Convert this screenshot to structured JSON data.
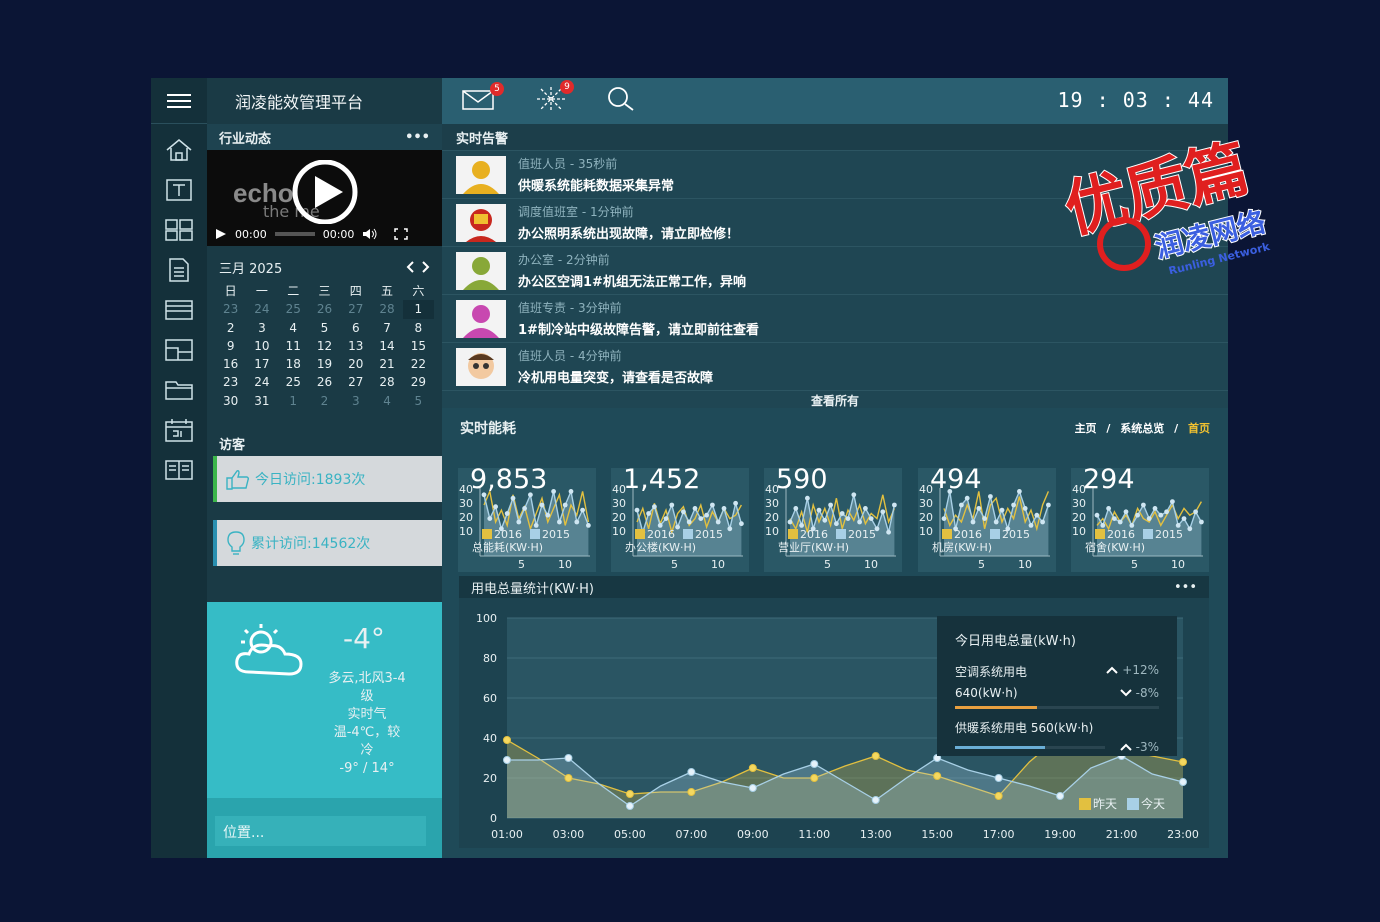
{
  "header": {
    "brand": "润凌能效管理平台",
    "mail_badge": "5",
    "alert_badge": "9",
    "clock": "19 : 03 : 44"
  },
  "sidebar": {
    "news_title": "行业动态",
    "menu": "•••",
    "video": {
      "brand_text1": "echo",
      "brand_text2": "the me",
      "time_current": "00:00",
      "time_total": "00:00"
    },
    "calendar": {
      "month": "三月 2025",
      "weekdays": [
        "日",
        "一",
        "二",
        "三",
        "四",
        "五",
        "六"
      ],
      "days": [
        "23",
        "24",
        "25",
        "26",
        "27",
        "28",
        "1",
        "2",
        "3",
        "4",
        "5",
        "6",
        "7",
        "8",
        "9",
        "10",
        "11",
        "12",
        "13",
        "14",
        "15",
        "16",
        "17",
        "18",
        "19",
        "20",
        "21",
        "22",
        "23",
        "24",
        "25",
        "26",
        "27",
        "28",
        "29",
        "30",
        "31",
        "1",
        "2",
        "3",
        "4",
        "5"
      ],
      "dim": [
        0,
        1,
        2,
        3,
        4,
        5,
        37,
        38,
        39,
        40,
        41
      ],
      "selected": 6
    },
    "visitors": {
      "title": "访客",
      "today": "今日访问:1893次",
      "total": "累计访问:14562次"
    },
    "weather": {
      "temp": "-4°",
      "line1": "多云,北风3-4",
      "line2": "级",
      "line3": "实时气",
      "line4": "温-4℃，较",
      "line5": "冷",
      "range": "-9° / 14°"
    },
    "location_placeholder": "位置..."
  },
  "alerts": {
    "title": "实时告警",
    "see_all": "查看所有",
    "items": [
      {
        "meta": "值班人员 - 35秒前",
        "msg": "供暖系统能耗数据采集异常",
        "avatar": "user-yellow"
      },
      {
        "meta": "调度值班室 - 1分钟前",
        "msg": "办公照明系统出现故障，请立即检修！",
        "avatar": "ironman"
      },
      {
        "meta": "办公室 - 2分钟前",
        "msg": "办公区空调1#机组无法正常工作，异响",
        "avatar": "user-green"
      },
      {
        "meta": "值班专责 - 3分钟前",
        "msg": "1#制冷站中级故障告警，请立即前往查看",
        "avatar": "user-pink"
      },
      {
        "meta": "值班人员 - 4分钟前",
        "msg": "冷机用电量突变，请查看是否故障",
        "avatar": "cartoon"
      }
    ]
  },
  "energy": {
    "title": "实时能耗",
    "breadcrumb": [
      "主页",
      "系统总览",
      "首页"
    ],
    "cards": [
      {
        "value": "9,853",
        "label": "总能耗(KW·H)"
      },
      {
        "value": "1,452",
        "label": "办公楼(KW·H)"
      },
      {
        "value": "590",
        "label": "营业厅(KW·H)"
      },
      {
        "value": "494",
        "label": "机房(KW·H)"
      },
      {
        "value": "294",
        "label": "宿舍(KW·H)"
      }
    ],
    "mini_legend": [
      "2016",
      "2015"
    ],
    "mini_y": [
      "40",
      "30",
      "20",
      "10"
    ],
    "mini_x": [
      "5",
      "10"
    ]
  },
  "chart_data": {
    "type": "area",
    "title": "用电总量统计(KW·H)",
    "menu": "•••",
    "x": [
      "01:00",
      "02:00",
      "03:00",
      "04:00",
      "05:00",
      "06:00",
      "07:00",
      "08:00",
      "09:00",
      "10:00",
      "11:00",
      "12:00",
      "13:00",
      "14:00",
      "15:00",
      "16:00",
      "17:00",
      "18:00",
      "19:00",
      "20:00",
      "21:00",
      "22:00",
      "23:00"
    ],
    "x_ticks": [
      "01:00",
      "03:00",
      "05:00",
      "07:00",
      "09:00",
      "11:00",
      "13:00",
      "15:00",
      "17:00",
      "19:00",
      "21:00",
      "23:00"
    ],
    "ylim": [
      0,
      100
    ],
    "y_ticks": [
      "0",
      "20",
      "40",
      "60",
      "80",
      "100"
    ],
    "series": [
      {
        "name": "昨天",
        "color": "#e2c040",
        "values": [
          39,
          30,
          20,
          17,
          12,
          13,
          13,
          18,
          25,
          20,
          20,
          26,
          31,
          24,
          21,
          16,
          11,
          28,
          41,
          38,
          34,
          31,
          28
        ]
      },
      {
        "name": "今天",
        "color": "#a8d0e6",
        "values": [
          29,
          29,
          30,
          17,
          6,
          16,
          23,
          18,
          15,
          22,
          27,
          18,
          9,
          20,
          30,
          24,
          20,
          16,
          11,
          25,
          31,
          22,
          18
        ]
      }
    ],
    "tooltip": {
      "title": "今日用电总量(kW·h)",
      "r1_label": "空调系统用电",
      "r1_value": "640(kW·h)",
      "r1_up": "+12%",
      "r1_down": "-8%",
      "r2_label": "供暖系统用电 560(kW·h)",
      "r2_down": "-3%",
      "colors": [
        "#e8a040",
        "#6aaed6"
      ]
    }
  },
  "watermark": {
    "main": "优质篇",
    "sub": "润凌网络",
    "sub_en": "Runling Network"
  }
}
